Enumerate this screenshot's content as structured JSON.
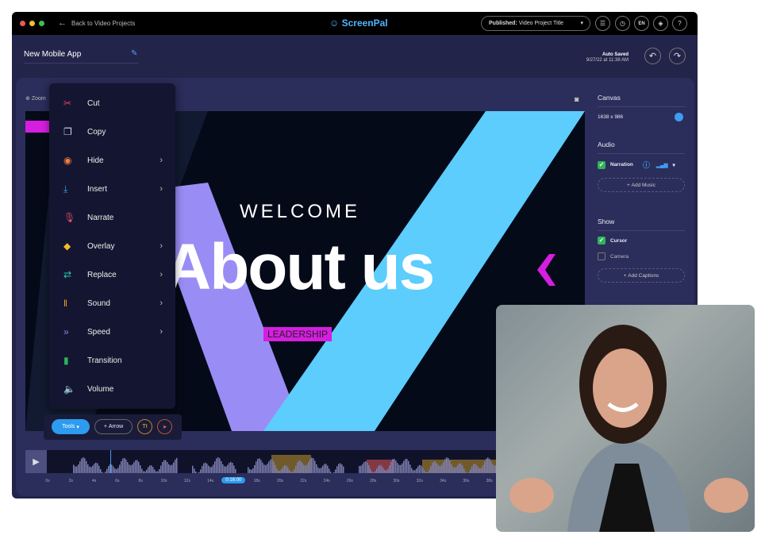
{
  "topbar": {
    "back_label": "Back to Video Projects",
    "logo": "ScreenPal",
    "published_label": "Published:",
    "published_title": "Video Project Title",
    "lang": "EN",
    "icons": [
      "checklist-icon",
      "history-icon",
      "language-icon",
      "layers-icon",
      "help-icon"
    ]
  },
  "header": {
    "project_title": "New Mobile App",
    "auto_saved": "Auto Saved",
    "saved_time": "9/27/22 at 11:38 AM"
  },
  "canvas_toolbar": {
    "zoom_label": "Zoom"
  },
  "video": {
    "welcome": "WELCOME",
    "headline": "About us",
    "tag": "LEADERSHIP",
    "colors": {
      "purple": "#9a8cf5",
      "cyan": "#5ccdfd",
      "magenta": "#d61ee0"
    }
  },
  "menu": {
    "items": [
      {
        "label": "Cut",
        "icon": "scissors-icon",
        "color": "#e6424f",
        "submenu": false
      },
      {
        "label": "Copy",
        "icon": "copy-icon",
        "color": "#cfd2e6",
        "submenu": false
      },
      {
        "label": "Hide",
        "icon": "eye-slash-icon",
        "color": "#f07f3c",
        "submenu": true
      },
      {
        "label": "Insert",
        "icon": "insert-icon",
        "color": "#3aa0f5",
        "submenu": true
      },
      {
        "label": "Narrate",
        "icon": "microphone-icon",
        "color": "#e64a6a",
        "submenu": false
      },
      {
        "label": "Overlay",
        "icon": "layers-icon",
        "color": "#f5b82e",
        "submenu": true
      },
      {
        "label": "Replace",
        "icon": "replace-icon",
        "color": "#2ec4b6",
        "submenu": true
      },
      {
        "label": "Sound",
        "icon": "waveform-icon",
        "color": "#f59a2e",
        "submenu": true
      },
      {
        "label": "Speed",
        "icon": "speed-icon",
        "color": "#8b7cf5",
        "submenu": true
      },
      {
        "label": "Transition",
        "icon": "transition-icon",
        "color": "#2fb45a",
        "submenu": false
      },
      {
        "label": "Volume",
        "icon": "volume-icon",
        "color": "#d64ad6",
        "submenu": false
      }
    ]
  },
  "tools": {
    "tools_label": "Tools",
    "arrow_label": "Arrow"
  },
  "right_panel": {
    "canvas_title": "Canvas",
    "canvas_size": "1638 x 986",
    "audio_title": "Audio",
    "narration_label": "Narration",
    "narration_checked": true,
    "add_music": "Add Music",
    "show_title": "Show",
    "cursor_label": "Cursor",
    "cursor_checked": true,
    "camera_label": "Camera",
    "camera_checked": false,
    "add_captions": "Add Captions"
  },
  "timeline": {
    "current_time": "0:16:00",
    "ticks": [
      "0s",
      "2s",
      "4s",
      "6s",
      "8s",
      "10s",
      "12s",
      "14s",
      "0:16:00",
      "18s",
      "20s",
      "22s",
      "24s",
      "26s",
      "28s",
      "30s",
      "32s",
      "34s",
      "36s",
      "38s"
    ]
  }
}
